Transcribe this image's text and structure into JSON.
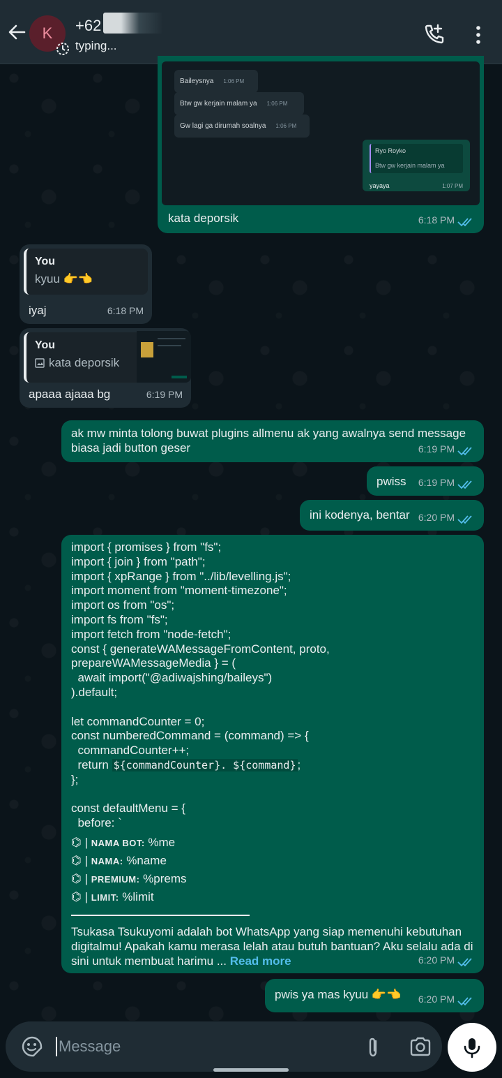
{
  "header": {
    "avatar_letter": "K",
    "contact_name": "+62",
    "status": "typing..."
  },
  "screenshot": {
    "messages": [
      {
        "text": "Baileysnya",
        "time": "1:06 PM"
      },
      {
        "text": "Btw gw kerjain malam ya",
        "time": "1:06 PM"
      },
      {
        "text": "Gw lagi ga dirumah soalnya",
        "time": "1:06 PM"
      }
    ],
    "reply": {
      "author": "Ryo Royko",
      "quoted": "Btw gw kerjain malam ya",
      "text": "yayaya",
      "time": "1:07 PM"
    }
  },
  "messages": [
    {
      "text": "kata deporsik",
      "time": "6:18 PM"
    },
    {
      "quote_author": "You",
      "quote_text": "kyuu 👉👈",
      "text": "iyaj",
      "time": "6:18 PM"
    },
    {
      "quote_author": "You",
      "quote_text": "kata deporsik",
      "text": "apaaa ajaaa bg",
      "time": "6:19 PM"
    },
    {
      "text": "ak mw minta tolong buwat plugins allmenu ak  yang awalnya send message biasa jadi button geser",
      "time": "6:19 PM"
    },
    {
      "text": "pwiss",
      "time": "6:19 PM"
    },
    {
      "text": "ini kodenya, bentar",
      "time": "6:20 PM"
    },
    {
      "text": "pwis ya mas kyuu 👉👈",
      "time": "6:20 PM"
    }
  ],
  "code_message": {
    "code_top": "import { promises } from \"fs\";\nimport { join } from \"path\";\nimport { xpRange } from \"../lib/levelling.js\";\nimport moment from \"moment-timezone\";\nimport os from \"os\";\nimport fs from \"fs\";\nimport fetch from \"node-fetch\";\nconst { generateWAMessageFromContent, proto,\nprepareWAMessageMedia } = (\n  await import(\"@adiwajshing/baileys\")\n).default;\n\nlet commandCounter = 0;\nconst numberedCommand = (command) => {\n  commandCounter++;",
    "return_prefix": "  return ",
    "return_mono": "${commandCounter}. ${command}",
    "return_suffix": ";",
    "code_mid": "};\n\nconst defaultMenu = {\n  before: `",
    "menu_lines": [
      {
        "bullet": "⌬ |",
        "label": "NAMA BOT:",
        "value": " %me"
      },
      {
        "bullet": "⌬ |",
        "label": "NAMA:",
        "value": "  %name"
      },
      {
        "bullet": "⌬ |",
        "label": "PREMIUM:",
        "value": " %prems"
      },
      {
        "bullet": "⌬ |",
        "label": "LIMIT:",
        "value": " %limit"
      }
    ],
    "description": "Tsukasa Tsukuyomi adalah bot WhatsApp yang siap memenuhi kebutuhan digitalmu! Apakah kamu merasa lelah atau butuh bantuan? Aku selalu ada di sini untuk membuat harimu ... ",
    "read_more": "Read more",
    "time": "6:20 PM"
  },
  "composer": {
    "placeholder": "Message"
  },
  "colors": {
    "outgoing": "#005c4b",
    "incoming": "#1f2c34",
    "read_tick": "#53bdeb"
  }
}
